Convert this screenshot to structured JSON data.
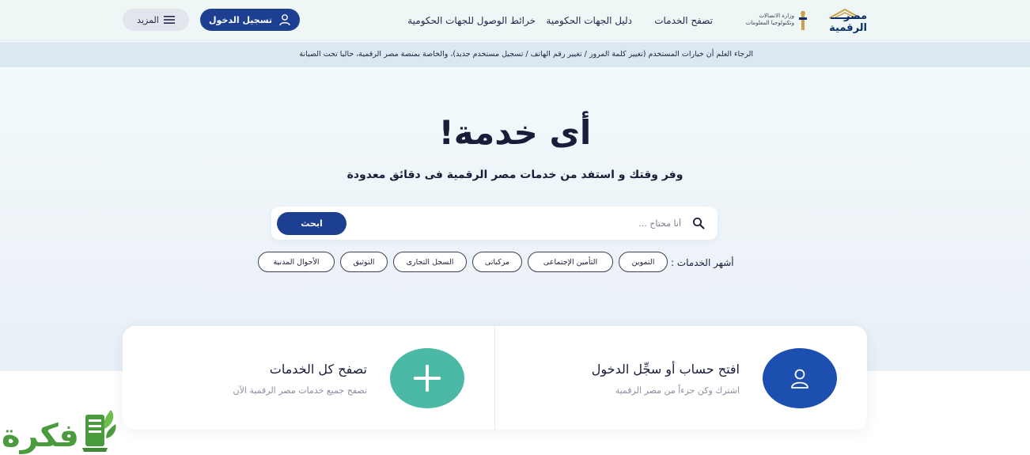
{
  "header": {
    "logo_text": "مصر الرقمية",
    "ministry_text": "وزارة الاتصالات وتكنولوجيا المعلومات",
    "nav": [
      "تصفح الخدمات",
      "دليل الجهات الحكومية",
      "خرائط الوصول للجهات الحكومية"
    ],
    "login_label": "تسجيل الدخول",
    "more_label": "المزيد"
  },
  "notice": {
    "text": "الرجاء العلم أن خيارات المستخدم (تغيير كلمة المرور / تغيير رقم الهاتف / تسجيل مستخدم جديد)، والخاصة بمنصة مصر الرقمية، حاليا تحت الصيانة"
  },
  "hero": {
    "title": "أى خدمة!",
    "subtitle": "وفر وقتك و استفد من خدمات مصر الرقمية فى دقائق معدودة",
    "search_placeholder": "أنا محتاج ...",
    "search_button": "ابحث",
    "popular_label": "أشهر الخدمات :",
    "chips": [
      "التموين",
      "التأمين الإجتماعى",
      "مركباتى",
      "السجل التجارى",
      "التوثيق",
      "الأحوال المدنية"
    ]
  },
  "cards": {
    "account": {
      "title": "افتح حساب أو سجِّل الدخول",
      "subtitle": "اشترك وكن جزءاً من مصر الرقمية",
      "icon": "user-icon"
    },
    "browse": {
      "title": "تصفح كل الخدمات",
      "subtitle": "تصفح جميع خدمات مصر الرقمية الآن",
      "icon": "plus-icon"
    }
  },
  "watermark": {
    "text": "فكرة"
  },
  "colors": {
    "primary": "#1c3f91",
    "accent_green": "#4cb8a6",
    "account_blue": "#1c4fb0",
    "header_bg": "#eef7f6",
    "notice_bg": "#dbe7f1"
  }
}
